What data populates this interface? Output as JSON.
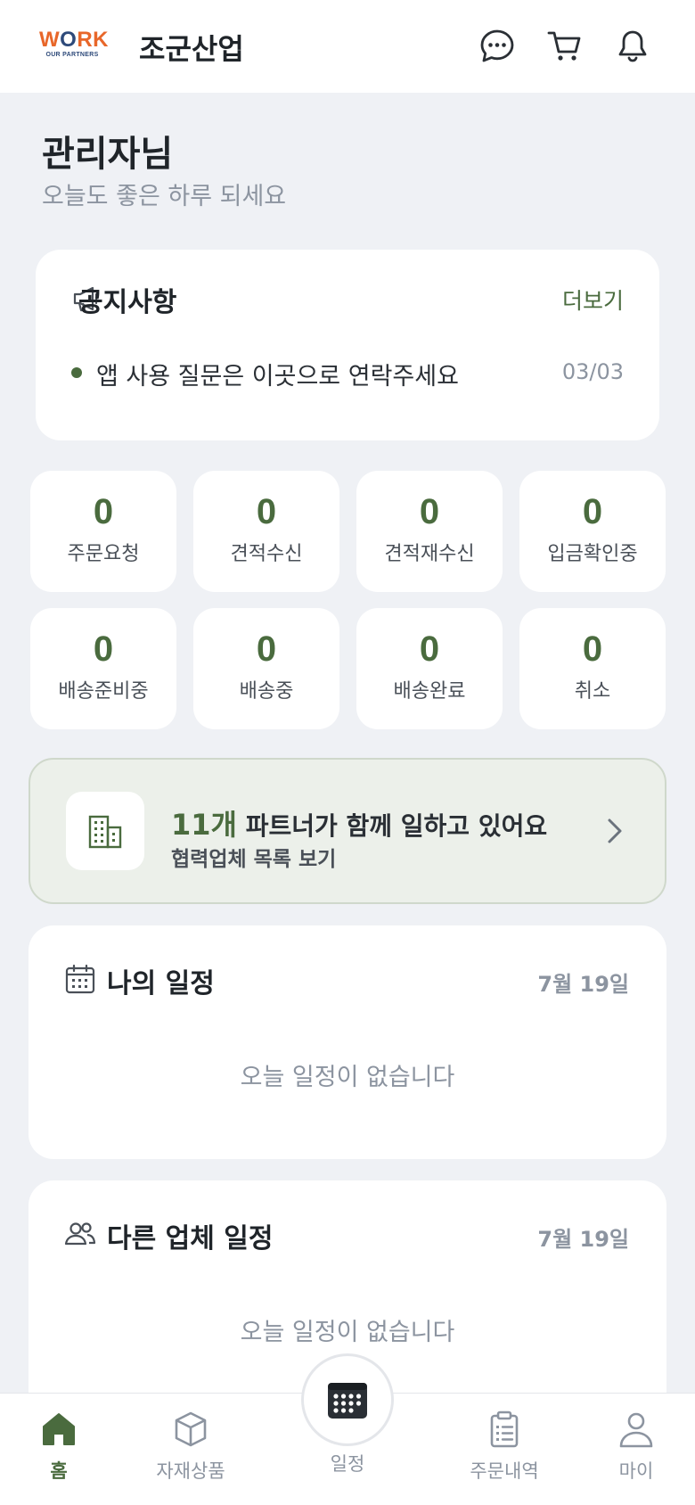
{
  "header": {
    "logo": {
      "word": "WORK",
      "sub": "OUR PARTNERS"
    },
    "brand": "조군산업",
    "icons": [
      "chat-icon",
      "cart-icon",
      "bell-icon"
    ]
  },
  "greeting": {
    "name": "관리자님",
    "sub": "오늘도 좋은 하루 되세요"
  },
  "notice": {
    "title": "공지사항",
    "more": "더보기",
    "items": [
      {
        "text": "앱 사용 질문은 이곳으로 연락주세요",
        "date": "03/03"
      }
    ]
  },
  "stats": [
    {
      "value": "0",
      "label": "주문요청"
    },
    {
      "value": "0",
      "label": "견적수신"
    },
    {
      "value": "0",
      "label": "견적재수신"
    },
    {
      "value": "0",
      "label": "입금확인중"
    },
    {
      "value": "0",
      "label": "배송준비중"
    },
    {
      "value": "0",
      "label": "배송중"
    },
    {
      "value": "0",
      "label": "배송완료"
    },
    {
      "value": "0",
      "label": "취소"
    }
  ],
  "partner": {
    "count": "11개",
    "text": " 파트너가 함께 일하고 있어요",
    "link": "협력업체 목록 보기"
  },
  "my_schedule": {
    "title": "나의 일정",
    "date": "7월 19일",
    "empty": "오늘 일정이 없습니다"
  },
  "other_schedule": {
    "title": "다른 업체 일정",
    "date": "7월 19일",
    "empty": "오늘 일정이 없습니다"
  },
  "nav": {
    "items": [
      {
        "label": "홈",
        "icon": "home-icon"
      },
      {
        "label": "자재상품",
        "icon": "box-icon"
      },
      {
        "label": "일정",
        "icon": "calendar-icon"
      },
      {
        "label": "주문내역",
        "icon": "clipboard-icon"
      },
      {
        "label": "마이",
        "icon": "user-icon"
      }
    ]
  },
  "colors": {
    "accent": "#4a6b3e",
    "logo_orange": "#e8672a",
    "logo_navy": "#2e4a7a",
    "background": "#eff1f5"
  }
}
